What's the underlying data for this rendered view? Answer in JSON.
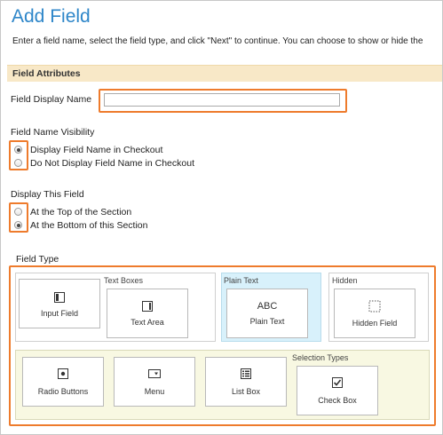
{
  "page": {
    "title": "Add Field",
    "intro": "Enter a field name, select the field type, and click \"Next\" to continue. You can choose to show or hide the"
  },
  "attributes": {
    "section_title": "Field Attributes",
    "display_name_label": "Field Display Name",
    "display_name_value": "",
    "visibility_label": "Field Name Visibility",
    "visibility_options": [
      "Display Field Name in Checkout",
      "Do Not Display Field Name in Checkout"
    ],
    "visibility_selected": "Display Field Name in Checkout",
    "position_label": "Display This Field",
    "position_options": [
      "At the Top of the Section",
      "At the Bottom of this Section"
    ],
    "position_selected": "At the Bottom of this Section"
  },
  "field_type": {
    "label": "Field Type",
    "groups": {
      "text_boxes": "Text Boxes",
      "plain_text": "Plain Text",
      "hidden": "Hidden",
      "selection_types": "Selection Types"
    },
    "cards": {
      "input_field": "Input Field",
      "text_area": "Text Area",
      "plain_text_icon": "ABC",
      "plain_text": "Plain Text",
      "hidden_field": "Hidden Field",
      "radio_buttons": "Radio Buttons",
      "menu": "Menu",
      "list_box": "List Box",
      "check_box": "Check Box"
    }
  },
  "colors": {
    "title_blue": "#2e86c9",
    "highlight_orange": "#ee7b2c",
    "section_bar": "#f8e8c7",
    "plain_text_group_bg": "#d8f1fb",
    "selection_group_bg": "#f8f8e2"
  }
}
